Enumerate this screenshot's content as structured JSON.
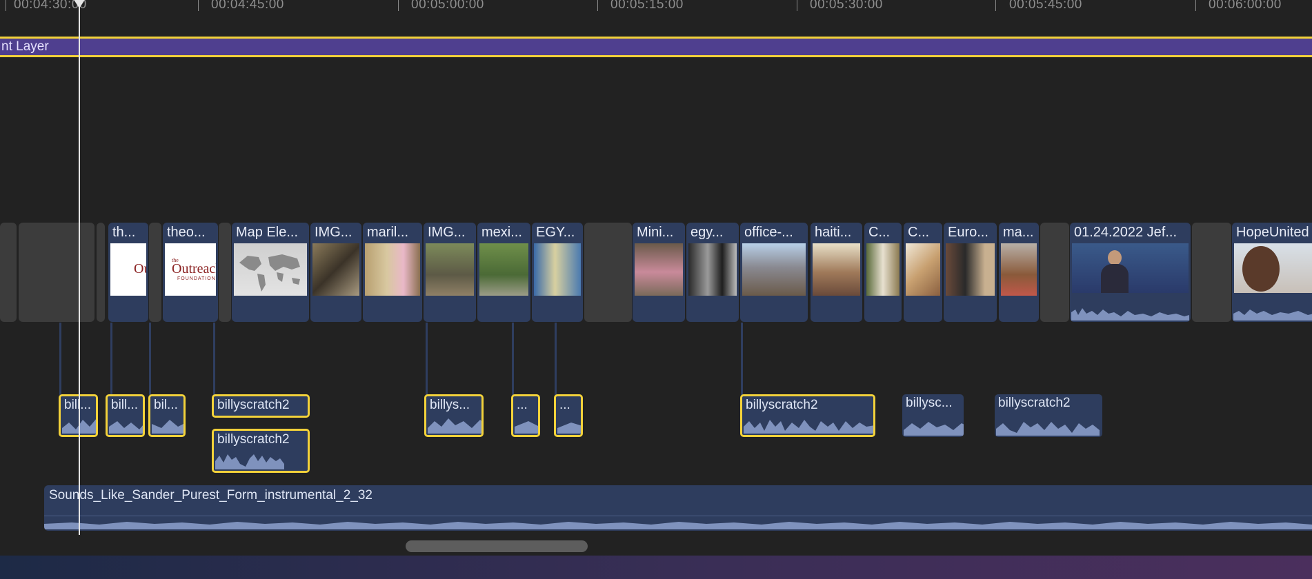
{
  "ruler": {
    "ticks": [
      {
        "label": "00:04:30:00"
      },
      {
        "label": "00:04:45:00"
      },
      {
        "label": "00:05:00:00"
      },
      {
        "label": "00:05:15:00"
      },
      {
        "label": "00:05:30:00"
      },
      {
        "label": "00:05:45:00"
      },
      {
        "label": "00:06:00:00"
      }
    ]
  },
  "adjustment_layer": {
    "label": "nt Layer"
  },
  "video_clips": [
    {
      "title": "th..."
    },
    {
      "title": "theo..."
    },
    {
      "title": "Map Ele..."
    },
    {
      "title": "IMG..."
    },
    {
      "title": "maril..."
    },
    {
      "title": "IMG..."
    },
    {
      "title": "mexi..."
    },
    {
      "title": "EGY..."
    },
    {
      "title": "Mini..."
    },
    {
      "title": "egy..."
    },
    {
      "title": "office-..."
    },
    {
      "title": "haiti..."
    },
    {
      "title": "C..."
    },
    {
      "title": "C..."
    },
    {
      "title": "Euro..."
    },
    {
      "title": "ma..."
    },
    {
      "title": "01.24.2022 Jef..."
    },
    {
      "title": "HopeUnited"
    }
  ],
  "thumb_text": {
    "small": "the",
    "main": "Outreach",
    "sub": "FOUNDATION",
    "partial": "Ou"
  },
  "audio_clips": [
    {
      "title": "bill..."
    },
    {
      "title": "bill..."
    },
    {
      "title": "bil..."
    },
    {
      "title": "billyscratch2"
    },
    {
      "title": "billyscratch2"
    },
    {
      "title": "billys..."
    },
    {
      "title": "..."
    },
    {
      "title": "..."
    },
    {
      "title": "billyscratch2"
    },
    {
      "title": "billysc..."
    },
    {
      "title": "billyscratch2"
    }
  ],
  "music_track": {
    "title": "Sounds_Like_Sander_Purest_Form_instrumental_2_32"
  },
  "colors": {
    "background": "#222222",
    "clip": "#2e3d5e",
    "selection": "#f3d23a",
    "adjustment_layer": "#4f3f8f",
    "waveform": "#7f92bd"
  }
}
